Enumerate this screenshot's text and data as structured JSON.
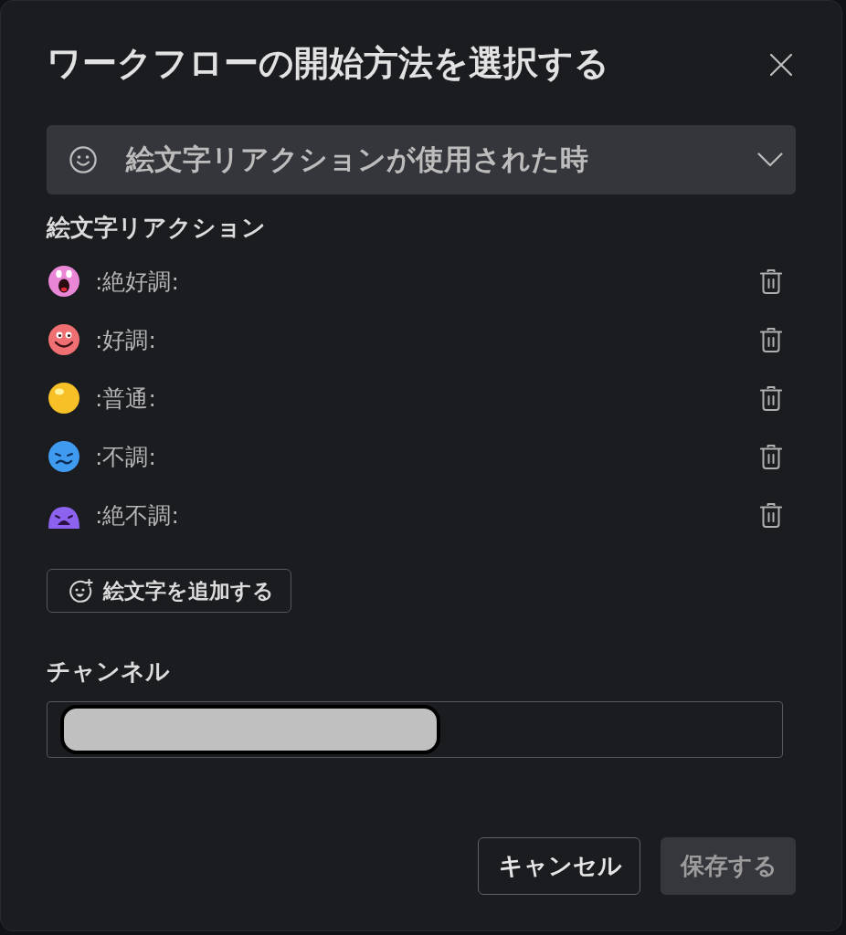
{
  "dialog": {
    "title": "ワークフローの開始方法を選択する"
  },
  "trigger": {
    "value": "絵文字リアクションが使用された時"
  },
  "reactions": {
    "label": "絵文字リアクション",
    "items": [
      {
        "name": ":絶好調:",
        "color": "#e987d6",
        "kind": "shocked"
      },
      {
        "name": ":好調:",
        "color": "#ef6f73",
        "kind": "smile"
      },
      {
        "name": ":普通:",
        "color": "#f6c026",
        "kind": "plain"
      },
      {
        "name": ":不調:",
        "color": "#3f9bef",
        "kind": "worried"
      },
      {
        "name": ":絶不調:",
        "color": "#8d62ee",
        "kind": "sad"
      }
    ]
  },
  "add_button": {
    "label": "絵文字を追加する"
  },
  "channel": {
    "label": "チャンネル"
  },
  "buttons": [
    {
      "label": "キャンセル",
      "kind": "secondary",
      "disabled": false
    },
    {
      "label": "保存する",
      "kind": "primary",
      "disabled": true
    }
  ]
}
